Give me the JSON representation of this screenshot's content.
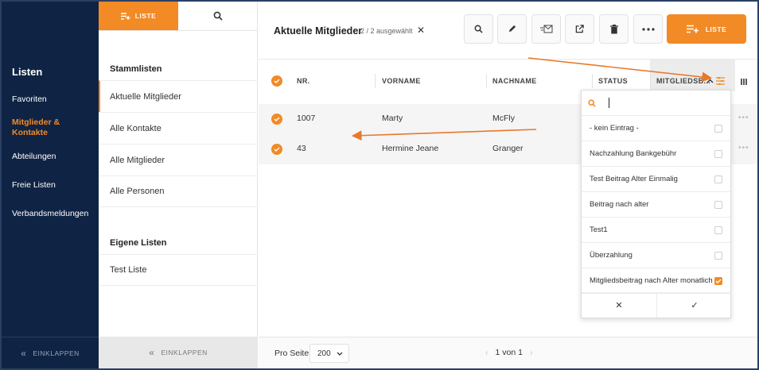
{
  "sidebar": {
    "title": "Listen",
    "items": [
      {
        "label": "Favoriten",
        "active": false
      },
      {
        "label": "Mitglieder & Kontakte",
        "active": true
      },
      {
        "label": "Abteilungen",
        "active": false
      },
      {
        "label": "Freie Listen",
        "active": false
      },
      {
        "label": "Verbandsmeldungen",
        "active": false
      }
    ],
    "collapse_label": "EINKLAPPEN"
  },
  "list_panel": {
    "tab_liste": "LISTE",
    "section_master": "Stammlisten",
    "master_items": [
      "Aktuelle Mitglieder",
      "Alle Kontakte",
      "Alle Mitglieder",
      "Alle Personen"
    ],
    "section_own": "Eigene Listen",
    "own_items": [
      "Test Liste"
    ],
    "collapse_label": "EINKLAPPEN"
  },
  "header": {
    "title": "Aktuelle Mitglieder",
    "selection": "2 / 2 ausgewählt",
    "clear": "✕",
    "liste_button": "LISTE"
  },
  "table": {
    "columns": [
      "NR.",
      "VORNAME",
      "NACHNAME",
      "STATUS",
      "MITGLIEDSB..."
    ],
    "rows": [
      {
        "nr": "1007",
        "vorname": "Marty",
        "nachname": "McFly"
      },
      {
        "nr": "43",
        "vorname": "Hermine Jeane",
        "nachname": "Granger"
      }
    ]
  },
  "filter_dropdown": {
    "search_value": "",
    "options": [
      {
        "label": "- kein Eintrag -",
        "checked": false
      },
      {
        "label": "Nachzahlung Bankgebühr",
        "checked": false
      },
      {
        "label": "Test Beitrag Alter Einmalig",
        "checked": false
      },
      {
        "label": "Beitrag nach alter",
        "checked": false
      },
      {
        "label": "Test1",
        "checked": false
      },
      {
        "label": "Überzahlung",
        "checked": false
      },
      {
        "label": "Mitgliedsbeitrag nach Alter monatlich",
        "checked": true
      }
    ],
    "cancel": "✕",
    "confirm": "✓"
  },
  "footer": {
    "per_page_label": "Pro Seite",
    "per_page_value": "200",
    "pagination": "1 von 1"
  },
  "colors": {
    "accent": "#f28a26",
    "navy": "#0f2344"
  },
  "icons": [
    "search-icon",
    "edit-icon",
    "mail-icon",
    "export-icon",
    "trash-icon",
    "more-icon",
    "list-add-icon",
    "filter-icon",
    "columns-icon"
  ]
}
